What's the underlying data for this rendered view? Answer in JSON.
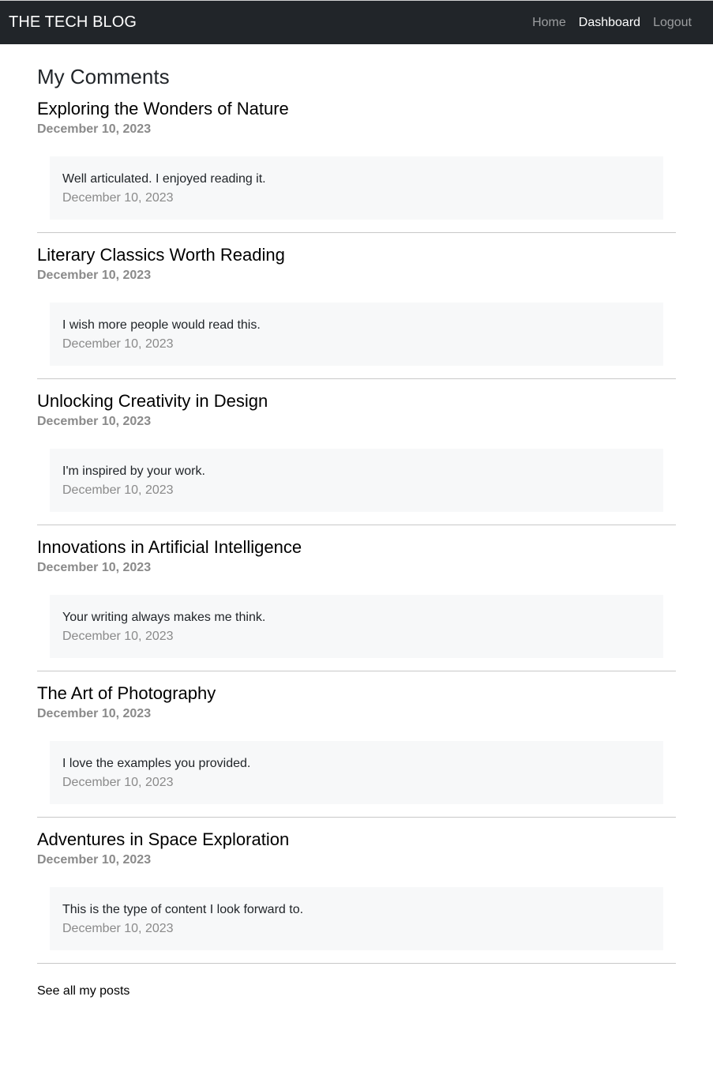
{
  "navbar": {
    "brand": "THE TECH BLOG",
    "links": [
      {
        "label": "Home",
        "active": false
      },
      {
        "label": "Dashboard",
        "active": true
      },
      {
        "label": "Logout",
        "active": false
      }
    ]
  },
  "page": {
    "title": "My Comments",
    "see_all_link": "See all my posts"
  },
  "posts": [
    {
      "title": "Exploring the Wonders of Nature",
      "date": "December 10, 2023",
      "comment": {
        "text": "Well articulated. I enjoyed reading it.",
        "date": "December 10, 2023"
      }
    },
    {
      "title": "Literary Classics Worth Reading",
      "date": "December 10, 2023",
      "comment": {
        "text": "I wish more people would read this.",
        "date": "December 10, 2023"
      }
    },
    {
      "title": "Unlocking Creativity in Design",
      "date": "December 10, 2023",
      "comment": {
        "text": "I'm inspired by your work.",
        "date": "December 10, 2023"
      }
    },
    {
      "title": "Innovations in Artificial Intelligence",
      "date": "December 10, 2023",
      "comment": {
        "text": "Your writing always makes me think.",
        "date": "December 10, 2023"
      }
    },
    {
      "title": "The Art of Photography",
      "date": "December 10, 2023",
      "comment": {
        "text": "I love the examples you provided.",
        "date": "December 10, 2023"
      }
    },
    {
      "title": "Adventures in Space Exploration",
      "date": "December 10, 2023",
      "comment": {
        "text": "This is the type of content I look forward to.",
        "date": "December 10, 2023"
      }
    }
  ],
  "colors": {
    "navbar_bg": "#212529",
    "comment_bg": "#f7f8f9",
    "muted_text": "#8a8a8a"
  }
}
